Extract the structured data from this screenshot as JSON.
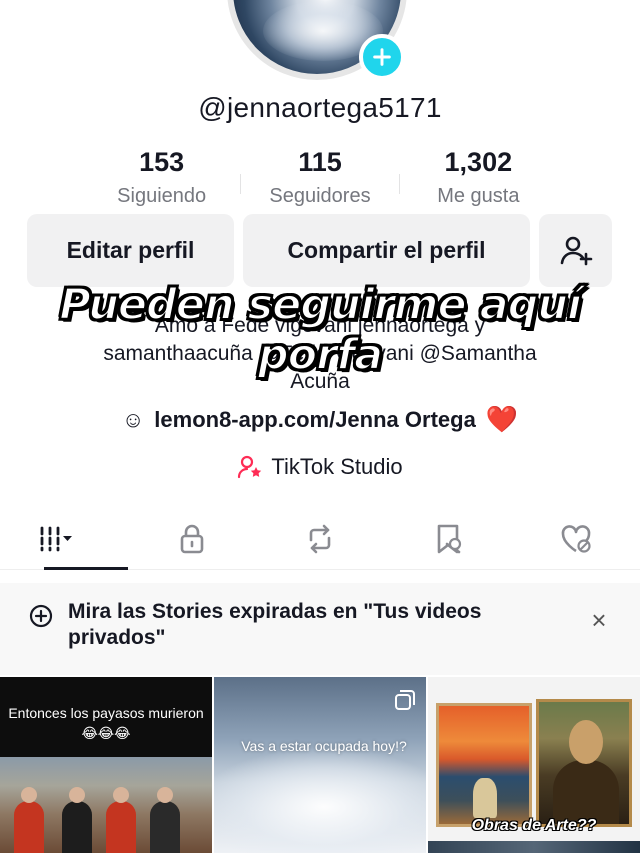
{
  "profile": {
    "username": "@jennaortega5171",
    "stats": [
      {
        "value": "153",
        "label": "Siguiendo"
      },
      {
        "value": "115",
        "label": "Seguidores"
      },
      {
        "value": "1,302",
        "label": "Me gusta"
      }
    ]
  },
  "actions": {
    "edit_label": "Editar perfil",
    "share_label": "Compartir el perfil",
    "add_friend_icon": "add-user-icon"
  },
  "overlay": {
    "caption": "Pueden seguirme aquí porfa"
  },
  "bio": {
    "line1_partial": "Amo a Fede vigevani jennaortega y",
    "line2": "samanthaacuña @Fede Vigevani @Samantha",
    "line3": "Acuña",
    "link_icon": "☺",
    "link": "lemon8-app.com/Jenna Ortega",
    "heart": "❤️",
    "studio": "TikTok Studio"
  },
  "tabs": [
    {
      "name": "videos-grid",
      "icon": "grid-icon",
      "active": true
    },
    {
      "name": "private",
      "icon": "lock-icon",
      "active": false
    },
    {
      "name": "reposts",
      "icon": "repost-icon",
      "active": false
    },
    {
      "name": "favorites",
      "icon": "bookmark-icon",
      "active": false
    },
    {
      "name": "liked",
      "icon": "heart-hidden-icon",
      "active": false
    }
  ],
  "stories_banner": {
    "text": "Mira las Stories expiradas en \"Tus videos privados\"",
    "close": "×"
  },
  "videos": [
    {
      "caption": "Entonces los payasos murieron 😂😂😂"
    },
    {
      "caption": "Vas a estar ocupada hoy!?"
    },
    {
      "caption": "Obras de Arte??"
    }
  ],
  "colors": {
    "accent": "#20d5ec",
    "button_bg": "#f1f1f2",
    "text": "#161823",
    "muted": "#75777e",
    "heart": "#e5282a",
    "studio_pink": "#fe2c55"
  }
}
